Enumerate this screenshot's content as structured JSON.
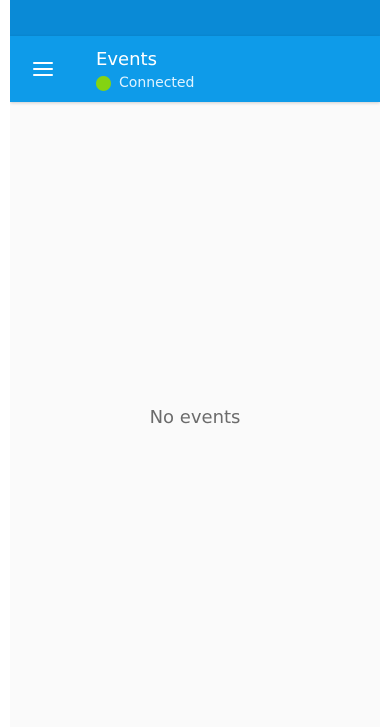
{
  "app_bar": {
    "title": "Events",
    "connection_status": "Connected",
    "status_color": "#84d312",
    "menu_icon": "hamburger-menu-icon"
  },
  "content": {
    "empty_message": "No events"
  },
  "colors": {
    "status_bar": "#0a8ad6",
    "app_bar": "#0e9be9",
    "background": "#fafafa",
    "empty_text": "#6b6b6b"
  }
}
